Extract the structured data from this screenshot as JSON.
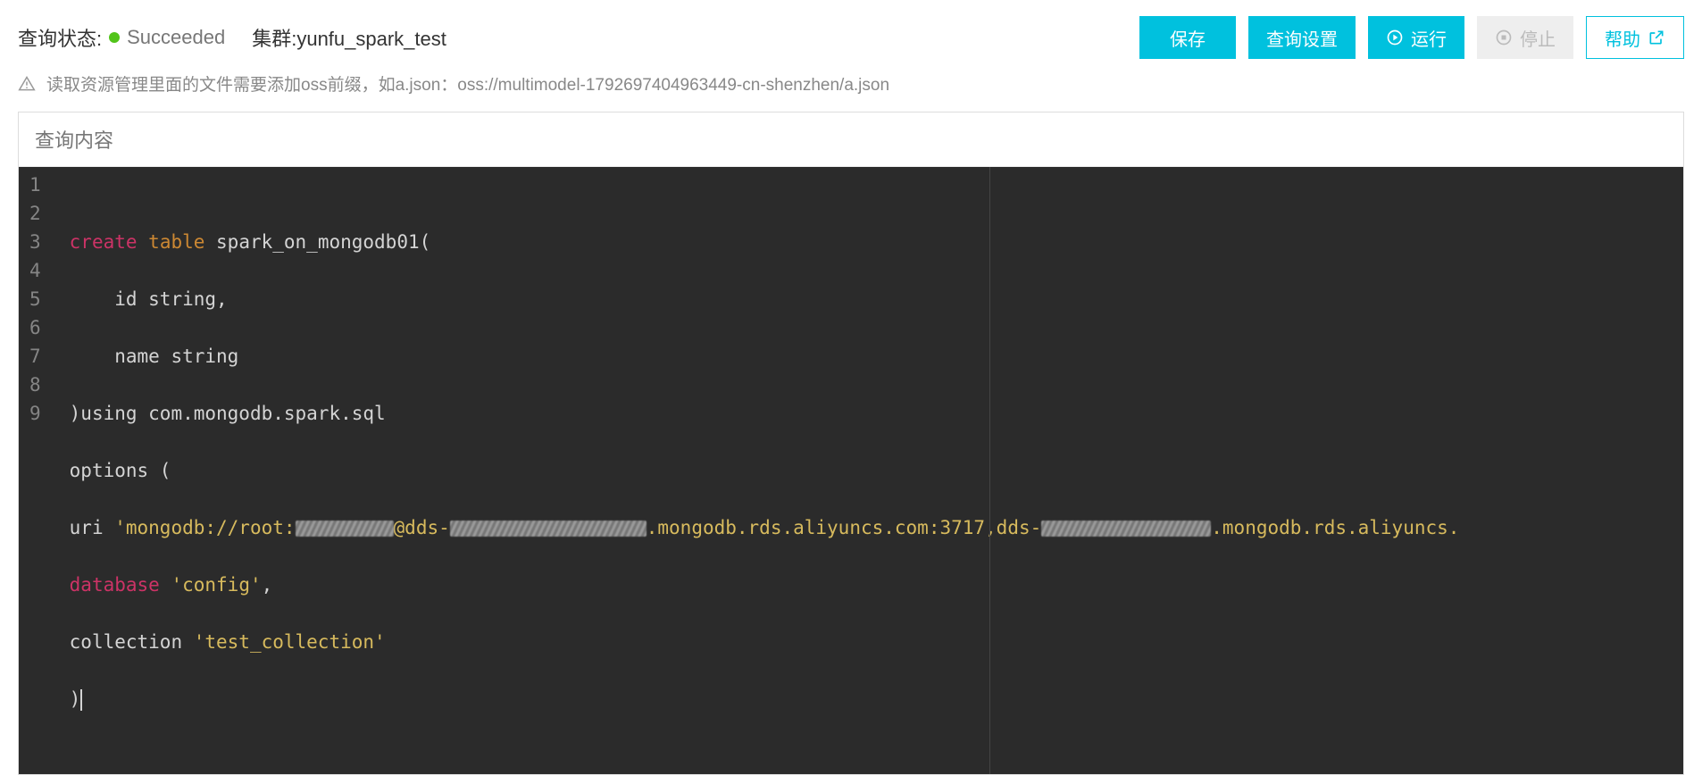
{
  "header": {
    "status_label": "查询状态:",
    "status_value": "Succeeded",
    "status_color": "#52c41a",
    "cluster_label": "集群:yunfu_spark_test",
    "buttons": {
      "save": "保存",
      "settings": "查询设置",
      "run": "运行",
      "stop": "停止",
      "help": "帮助"
    }
  },
  "notice": {
    "text": "读取资源管理里面的文件需要添加oss前缀，如a.json：oss://multimodel-1792697404963449-cn-shenzhen/a.json"
  },
  "editor": {
    "title": "查询内容",
    "line_numbers": [
      "1",
      "2",
      "3",
      "4",
      "5",
      "6",
      "7",
      "8",
      "9"
    ],
    "code": {
      "l1_kw1": "create",
      "l1_kw2": "table",
      "l1_rest": " spark_on_mongodb01(",
      "l2": "    id string,",
      "l3": "    name string",
      "l4": ")using com.mongodb.spark.sql",
      "l5": "options (",
      "l6a": "uri ",
      "l6s1": "'mongodb://root:",
      "l6mid1": "@dds-",
      "l6mid2": ".mongodb.rds.aliyuncs.com:3717,dds-",
      "l6end": ".mongodb.rds.aliyuncs.",
      "l7a": "database",
      "l7s": " 'config'",
      "l7c": ",",
      "l8a": "collection ",
      "l8s": "'test_collection'",
      "l9": ")"
    }
  }
}
